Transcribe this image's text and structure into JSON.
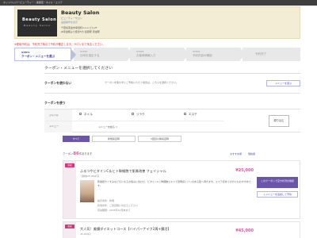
{
  "top_bar": "ホットペッパービューティー｜美容室・ネイル・エステ",
  "salon": {
    "logo_title": "Beauty Salon",
    "logo_sub": "Beauty Salon",
    "name": "Beauty Salon",
    "kana": "ビューティーサロン",
    "contact": "電話番号を表示",
    "address": "千葉県東金市幸田町1-1-1 ビル2F",
    "access": "JR東金駅より徒歩5分 最寄駅 東金駅"
  },
  "notice": "※即時予約は、予約完了時点で予約が確定します。サロンまで来店ください。",
  "steps": [
    {
      "num": "STEP1",
      "label": "クーポン・メニューを選ぶ"
    },
    {
      "num": "STEP2",
      "label": "日時を指定する"
    },
    {
      "num": "STEP3",
      "label": "お客様情報入力"
    },
    {
      "num": "STEP4",
      "label": "予約内容の確認"
    },
    {
      "num": "",
      "label": "予約完了"
    }
  ],
  "main_title": "クーポン・メニューを選択してください",
  "no_coupon": {
    "label": "クーポンを使わない",
    "note": "クーポンを使わずにご予約いただく場合は、こちらを選択ください。",
    "button": "メニューを選ぶ"
  },
  "use_coupon_label": "クーポンを使う",
  "filter": {
    "genre_label": "ジャンル",
    "menu_label": "メニュー",
    "genres": [
      "ネイル",
      "リラク",
      "エステ"
    ],
    "menu_value": "メニューを絞る",
    "apply_button": "絞り込む"
  },
  "tabs": [
    "すべて",
    "新規来店時",
    "2回目以降来店時"
  ],
  "count": {
    "prefix": "クーポン",
    "number": "86",
    "suffix": "件あります"
  },
  "sort": [
    "おすすめ順",
    "価格順"
  ],
  "coupons": [
    {
      "badge": "新規",
      "title": "ふるつやビタミンC＆ヒト幹細胞で肌質改善 フェイシャル",
      "sub": "【通常25,000円】",
      "price": "¥25,000",
      "desc": "乾燥肌やくすみなど気になるお悩みに合わせ、ビタミンCと幹細胞エキスで透明感とハリのある肌へ導きます。エステ初めての方にもおすすめです。",
      "meta1": "提示条件：新規",
      "meta2": "利用条件：ご来店時にお伝えください",
      "meta3": "有効期限：2025年12月末まで",
      "reserve": "このクーポンで空き状況を確認",
      "add_menu": "＋メニューを追加して予約"
    },
    {
      "badge": "新規",
      "title": "大人気！美腸ダイエットコース【ハイパーナイフ2周+腸活】",
      "sub": "45,000円",
      "price": "¥45,000"
    }
  ]
}
